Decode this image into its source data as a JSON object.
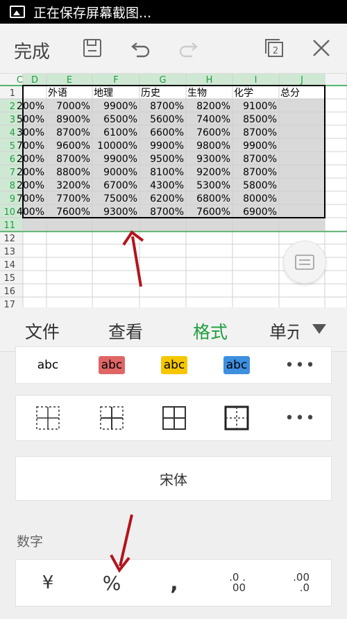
{
  "status_bar": {
    "text": "正在保存屏幕截图..."
  },
  "toolbar": {
    "done_label": "完成",
    "window_count": "2"
  },
  "sheet": {
    "columns": [
      "C",
      "D",
      "E",
      "F",
      "G",
      "H",
      "I",
      "J"
    ],
    "row_numbers": [
      "1",
      "2",
      "3",
      "4",
      "5",
      "6",
      "7",
      "8",
      "9",
      "10",
      "11",
      "12",
      "13",
      "14",
      "15",
      "16",
      "17"
    ],
    "header_row": [
      "",
      "外语",
      "地理",
      "历史",
      "生物",
      "化学",
      "总分"
    ],
    "rows": [
      [
        "200%",
        "7000%",
        "9900%",
        "8700%",
        "8200%",
        "9100%"
      ],
      [
        "500%",
        "8900%",
        "6500%",
        "5600%",
        "7400%",
        "8500%"
      ],
      [
        "300%",
        "8700%",
        "6100%",
        "6600%",
        "7600%",
        "8700%"
      ],
      [
        "700%",
        "9600%",
        "10000%",
        "9900%",
        "9800%",
        "9900%"
      ],
      [
        "200%",
        "8700%",
        "9900%",
        "9500%",
        "9300%",
        "8700%"
      ],
      [
        "200%",
        "8800%",
        "9000%",
        "8100%",
        "9200%",
        "8700%"
      ],
      [
        "200%",
        "3200%",
        "6700%",
        "4300%",
        "5300%",
        "5800%"
      ],
      [
        "700%",
        "7700%",
        "7500%",
        "6200%",
        "6800%",
        "8000%"
      ],
      [
        "400%",
        "7600%",
        "9300%",
        "8700%",
        "7600%",
        "6900%"
      ]
    ]
  },
  "tabs": [
    "文件",
    "查看",
    "格式",
    "单元"
  ],
  "format_panel": {
    "text_styles": [
      {
        "label": "abc",
        "bg": "",
        "color": "#000000"
      },
      {
        "label": "abc",
        "bg": "#e06666",
        "color": "#333333"
      },
      {
        "label": "abc",
        "bg": "#f6c700",
        "color": "#333333"
      },
      {
        "label": "abc",
        "bg": "#3d8fe0",
        "color": "#222222"
      }
    ],
    "more_label": "•••",
    "font_name": "宋体",
    "number_section": "数字",
    "number_formats": [
      "¥",
      "%",
      ",",
      ".0 .00",
      ".00 .0"
    ]
  },
  "colors": {
    "accent": "#1e9e3e",
    "annotation_arrow": "#b3141c",
    "selection": "#d9d9d9"
  }
}
